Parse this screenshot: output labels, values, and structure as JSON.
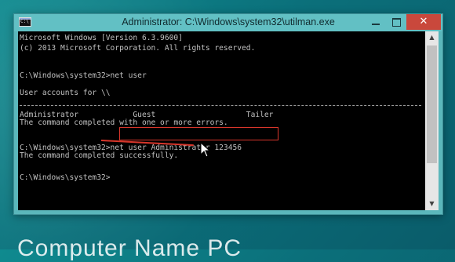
{
  "window": {
    "title": "Administrator: C:\\Windows\\system32\\utilman.exe",
    "minimize_symbol": "",
    "maximize_symbol": "",
    "close_symbol": "✕"
  },
  "console": {
    "lines": [
      "Microsoft Windows [Version 6.3.9600]",
      "(c) 2013 Microsoft Corporation. All rights reserved.",
      "",
      "C:\\Windows\\system32>net user",
      "",
      "User accounts for \\\\",
      "",
      "",
      "Administrator            Guest                    Tailer",
      "The command completed with one or more errors.",
      "",
      "C:\\Windows\\system32>net user Administrator 123456",
      "The command completed successfully.",
      "",
      "C:\\Windows\\system32>"
    ]
  },
  "desktop": {
    "bottom_text": "Computer Name PC"
  },
  "colors": {
    "desktop_bg": "#0b6f7a",
    "titlebar": "#62c0c4",
    "console_bg": "#000000",
    "console_text": "#c0c0c0",
    "highlight": "#d9362b",
    "close_button": "#c9483c"
  },
  "icons": {
    "window_icon": "cmd-icon",
    "cursor": "mouse-pointer-icon"
  }
}
